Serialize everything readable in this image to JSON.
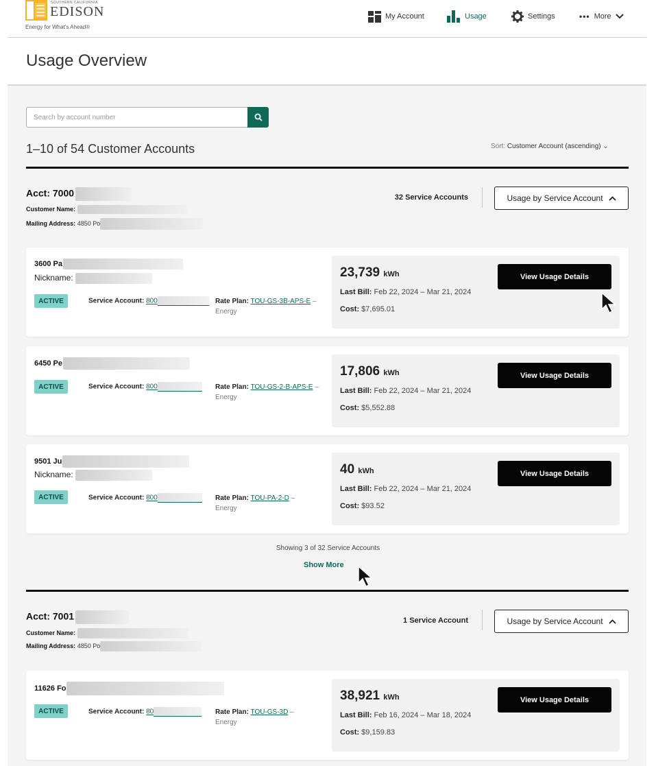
{
  "header": {
    "logo": {
      "small_text": "SOUTHERN CALIFORNIA",
      "name": "EDISON",
      "tagline": "Energy for What's Ahead®"
    },
    "nav": [
      {
        "label": "My Account",
        "icon": "dashboard-icon"
      },
      {
        "label": "Usage",
        "icon": "bar-chart-icon",
        "active": true
      },
      {
        "label": "Settings",
        "icon": "gear-icon"
      },
      {
        "label": "More",
        "icon": "ellipsis-icon"
      }
    ]
  },
  "page_title": "Usage Overview",
  "search": {
    "placeholder": "Search by account number",
    "value": ""
  },
  "results_count": "1–10 of 54 Customer Accounts",
  "sort": {
    "label": "Sort:",
    "value": "Customer Account (ascending)"
  },
  "labels": {
    "customer_name": "Customer Name:",
    "mailing_address": "Mailing Address:",
    "nickname": "Nickname:",
    "status": "ACTIVE",
    "service_account": "Service Account:",
    "rate_plan": "Rate Plan:",
    "last_bill": "Last Bill:",
    "cost": "Cost:",
    "kwh_unit": "kWh",
    "usage_by_service_account": "Usage by Service Account",
    "view_usage_details": "View Usage Details"
  },
  "accounts": [
    {
      "acct": "Acct: 7000",
      "mailing_address": "4850 Po",
      "service_count": "32 Service Accounts",
      "services": [
        {
          "address": "3600 Pa",
          "has_nickname": true,
          "service_account": "800",
          "rate_plan": "TOU-GS-3B-APS-E",
          "rate_plan_suffix": "Energy",
          "kwh": "23,739",
          "last_bill": "Feb 22, 2024 – Mar 21, 2024",
          "cost": "$7,695.01"
        },
        {
          "address": "6450 Pe",
          "has_nickname": false,
          "service_account": "800",
          "rate_plan": "TOU-GS-2-B-APS-E",
          "rate_plan_suffix": "Energy",
          "kwh": "17,806",
          "last_bill": "Feb 22, 2024 – Mar 21, 2024",
          "cost": "$5,552.88"
        },
        {
          "address": "9501 Ju",
          "has_nickname": true,
          "service_account": "800",
          "rate_plan": "TOU-PA-2-D",
          "rate_plan_suffix": "Energy",
          "kwh": "40",
          "last_bill": "Feb 22, 2024 – Mar 21, 2024",
          "cost": "$93.52"
        }
      ],
      "showing": "Showing 3 of 32 Service Accounts",
      "show_more": "Show More"
    },
    {
      "acct": "Acct: 7001",
      "mailing_address": "4850 Po",
      "service_count": "1 Service Account",
      "services": [
        {
          "address": "11626 Fo",
          "has_nickname": false,
          "service_account": "80",
          "rate_plan": "TOU-GS-3D",
          "rate_plan_suffix": "Energy",
          "kwh": "38,921",
          "last_bill": "Feb 16, 2024 – Mar 18, 2024",
          "cost": "$9,159.83"
        }
      ]
    }
  ],
  "colors": {
    "brand_green": "#0e6a57",
    "active_badge": "#7fd1c9",
    "button_dark": "#050505"
  }
}
